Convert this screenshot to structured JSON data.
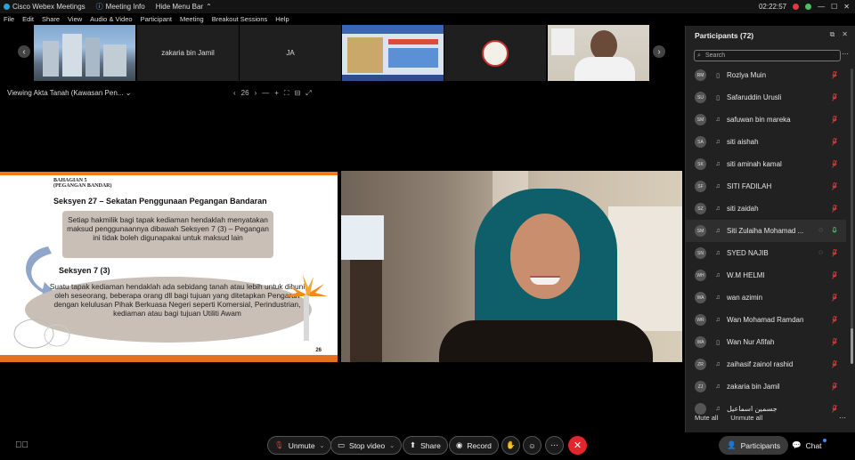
{
  "titlebar": {
    "app_name": "Cisco Webex Meetings",
    "meeting_info": "Meeting Info",
    "hide_menu_bar": "Hide Menu Bar",
    "time": "02:22:57"
  },
  "menu": [
    "File",
    "Edit",
    "Share",
    "View",
    "Audio & Video",
    "Participant",
    "Meeting",
    "Breakout Sessions",
    "Help"
  ],
  "filmstrip": {
    "tiles": [
      {
        "label": ""
      },
      {
        "label": "zakaria bin Jamil"
      },
      {
        "label": "JA"
      },
      {
        "label": ""
      },
      {
        "label": ""
      },
      {
        "label": ""
      }
    ]
  },
  "share": {
    "title": "Viewing Akta Tanah (Kawasan Pen...",
    "page": "26",
    "controls": [
      "‹",
      "26",
      "›",
      "—",
      "+",
      "⛶",
      "⊟",
      "⤢"
    ]
  },
  "slide": {
    "section_heading": "BAHAGIAN 5",
    "section_sub": "(PEGANGAN BANDAR)",
    "title": "Seksyen 27 – Sekatan Penggunaan Pegangan Bandaran",
    "box1_text": "Setiap hakmilik bagi tapak kediaman hendaklah menyatakan maksud penggunaannya dibawah Seksyen 7 (3) – Pegangan ini tidak boleh digunapakai untuk maksud lain",
    "subtitle": "Seksyen 7 (3)",
    "box2_text": "Suatu tapak kediaman hendaklah ada sebidang tanah atau lebih untuk dihuni oleh seseorang, beberapa orang dll bagi tujuan yang ditetapkan Pengarah dengan kelulusan Pihak Berkuasa Negeri seperti Komersial, Perindustrian, kediaman atau bagi tujuan Utiliti Awam",
    "page_number": "26"
  },
  "participants_panel": {
    "title": "Participants (72)",
    "search_placeholder": "Search",
    "mute_all": "Mute all",
    "unmute_all": "Unmute all",
    "participants": [
      {
        "initials": "RM",
        "name": "Rozlya Muin",
        "device": "phone",
        "mic": "muted",
        "highlight": false
      },
      {
        "initials": "SU",
        "name": "Safaruddin Urusli",
        "device": "phone",
        "mic": "muted",
        "highlight": false
      },
      {
        "initials": "SM",
        "name": "safuwan bin mareka",
        "device": "headset",
        "mic": "muted",
        "highlight": false
      },
      {
        "initials": "SA",
        "name": "siti aishah",
        "device": "headset",
        "mic": "muted",
        "highlight": false
      },
      {
        "initials": "SK",
        "name": "siti aminah kamal",
        "device": "headset",
        "mic": "muted",
        "highlight": false
      },
      {
        "initials": "SF",
        "name": "SITI FADILAH",
        "device": "headset",
        "mic": "muted",
        "highlight": false
      },
      {
        "initials": "SZ",
        "name": "siti zaidah",
        "device": "headset",
        "mic": "muted",
        "highlight": false
      },
      {
        "initials": "SM",
        "name": "Siti Zulaiha Mohamad ...",
        "device": "headset",
        "mic": "on",
        "highlight": true,
        "chat": true
      },
      {
        "initials": "SN",
        "name": "SYED NAJIB",
        "device": "headset",
        "mic": "muted",
        "highlight": false,
        "chat": true
      },
      {
        "initials": "WH",
        "name": "W.M HELMI",
        "device": "headset",
        "mic": "muted",
        "highlight": false
      },
      {
        "initials": "WA",
        "name": "wan azimin",
        "device": "headset",
        "mic": "muted",
        "highlight": false
      },
      {
        "initials": "WR",
        "name": "Wan Mohamad Ramdan",
        "device": "headset",
        "mic": "muted",
        "highlight": false
      },
      {
        "initials": "WA",
        "name": "Wan Nur Afifah",
        "device": "phone",
        "mic": "muted",
        "highlight": false
      },
      {
        "initials": "ZR",
        "name": "zaihasif zainol rashid",
        "device": "headset",
        "mic": "muted",
        "highlight": false
      },
      {
        "initials": "ZJ",
        "name": "zakaria bin Jamil",
        "device": "headset",
        "mic": "muted",
        "highlight": false
      },
      {
        "initials": "",
        "name": "جسمين اسماعيل",
        "device": "headset",
        "mic": "muted",
        "highlight": false
      }
    ]
  },
  "controls": {
    "unmute": "Unmute",
    "stop_video": "Stop video",
    "share": "Share",
    "record": "Record",
    "participants": "Participants",
    "chat": "Chat"
  },
  "colors": {
    "mute_red": "#e0393e",
    "mic_green": "#4dbd61",
    "end_red": "#e3262b",
    "slide_orange": "#f07a1a"
  }
}
